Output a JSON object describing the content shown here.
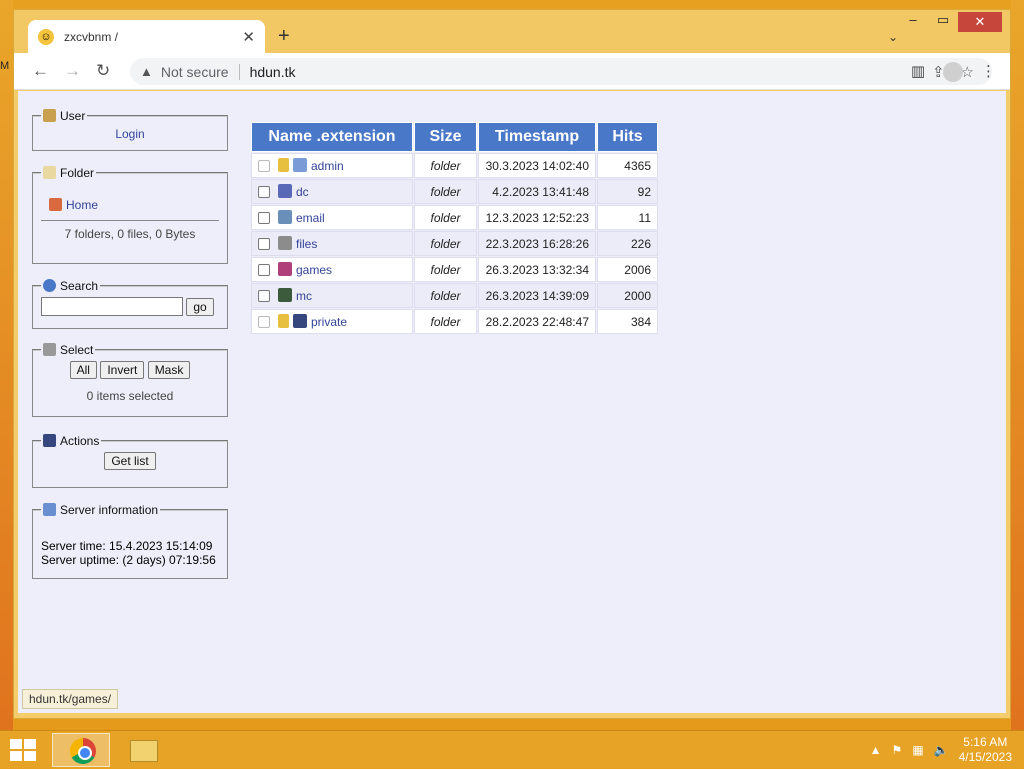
{
  "desktop": {
    "edge_text": "M"
  },
  "browser": {
    "tab_title": "zxcvbnm /",
    "new_tab": "+",
    "not_secure": "Not secure",
    "url": "hdun.tk",
    "status_url": "hdun.tk/games/"
  },
  "sidebar": {
    "user": {
      "legend": "User",
      "login": "Login"
    },
    "folder": {
      "legend": "Folder",
      "home": "Home",
      "summary": "7 folders, 0 files, 0 Bytes"
    },
    "search": {
      "legend": "Search",
      "value": "",
      "go": "go"
    },
    "select": {
      "legend": "Select",
      "all": "All",
      "invert": "Invert",
      "mask": "Mask",
      "count": "0 items selected"
    },
    "actions": {
      "legend": "Actions",
      "get_list": "Get list"
    },
    "server": {
      "legend": "Server information",
      "time": "Server time: 15.4.2023 15:14:09",
      "uptime": "Server uptime: (2 days) 07:19:56"
    }
  },
  "table": {
    "headers": {
      "name": "Name .extension",
      "size": "Size",
      "timestamp": "Timestamp",
      "hits": "Hits"
    },
    "rows": [
      {
        "name": "admin",
        "size": "folder",
        "timestamp": "30.3.2023 14:02:40",
        "hits": "4365",
        "locked": true,
        "icon": "server-icon"
      },
      {
        "name": "dc",
        "size": "folder",
        "timestamp": "4.2.2023 13:41:48",
        "hits": "92",
        "locked": false,
        "icon": "disc-icon"
      },
      {
        "name": "email",
        "size": "folder",
        "timestamp": "12.3.2023 12:52:23",
        "hits": "11",
        "locked": false,
        "icon": "email-icon"
      },
      {
        "name": "files",
        "size": "folder",
        "timestamp": "22.3.2023 16:28:26",
        "hits": "226",
        "locked": false,
        "icon": "drive-icon"
      },
      {
        "name": "games",
        "size": "folder",
        "timestamp": "26.3.2023 13:32:34",
        "hits": "2006",
        "locked": false,
        "icon": "games-icon"
      },
      {
        "name": "mc",
        "size": "folder",
        "timestamp": "26.3.2023 14:39:09",
        "hits": "2000",
        "locked": false,
        "icon": "block-icon"
      },
      {
        "name": "private",
        "size": "folder",
        "timestamp": "28.2.2023 22:48:47",
        "hits": "384",
        "locked": true,
        "icon": "floppy-icon"
      }
    ]
  },
  "taskbar": {
    "time": "5:16 AM",
    "date": "4/15/2023"
  },
  "colors": {
    "header_blue": "#4a78c8",
    "page_bg": "#eeeefa",
    "desktop_orange": "#e8a020"
  }
}
